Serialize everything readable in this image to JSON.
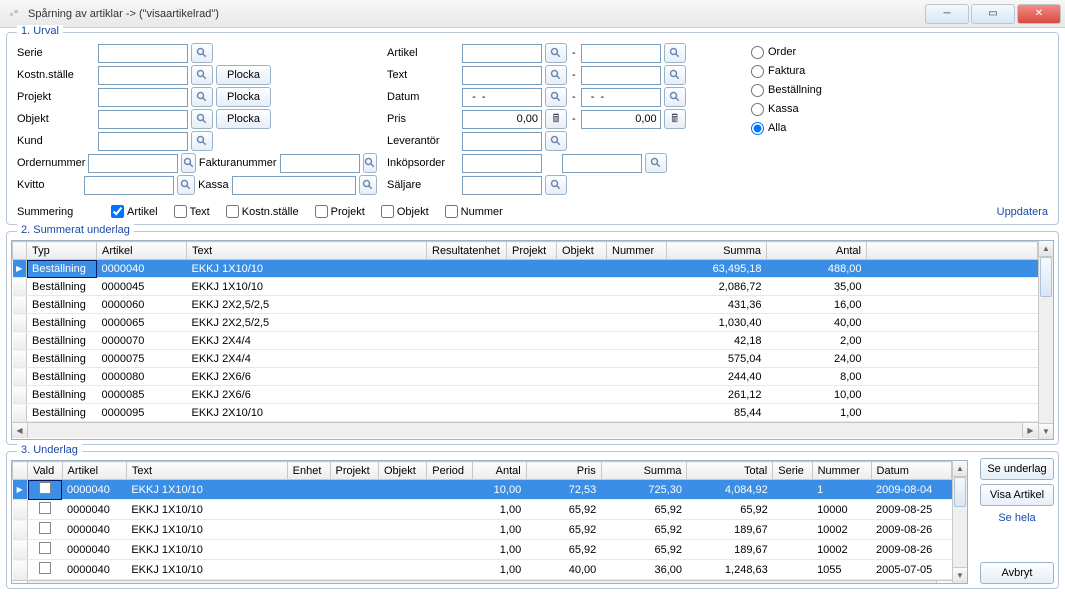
{
  "window": {
    "title": "Spårning av artiklar     -> (\"visaartikelrad\")"
  },
  "urval": {
    "title": "1. Urval",
    "labels": {
      "serie": "Serie",
      "kostn_stalle": "Kostn.ställe",
      "projekt": "Projekt",
      "objekt": "Objekt",
      "kund": "Kund",
      "ordernummer": "Ordernummer",
      "kvitto": "Kvitto",
      "artikel": "Artikel",
      "text": "Text",
      "datum": "Datum",
      "pris": "Pris",
      "leverantor": "Leverantör",
      "fakturanummer": "Fakturanummer",
      "inkopsorder": "Inköpsorder",
      "kassa": "Kassa",
      "saljare": "Säljare",
      "plocka": "Plocka"
    },
    "values": {
      "datum_from": "  -  -",
      "datum_to": "  -  -",
      "pris_from": "0,00",
      "pris_to": "0,00"
    },
    "radios": {
      "order": "Order",
      "faktura": "Faktura",
      "bestallning": "Beställning",
      "kassa": "Kassa",
      "alla": "Alla"
    },
    "summering": {
      "label": "Summering",
      "artikel": "Artikel",
      "text": "Text",
      "kostn_stalle": "Kostn.ställe",
      "projekt": "Projekt",
      "objekt": "Objekt",
      "nummer": "Nummer",
      "uppdatera": "Uppdatera"
    }
  },
  "summerat": {
    "title": "2. Summerat underlag",
    "headers": {
      "typ": "Typ",
      "artikel": "Artikel",
      "text": "Text",
      "resultatenhet": "Resultatenhet",
      "projekt": "Projekt",
      "objekt": "Objekt",
      "nummer": "Nummer",
      "summa": "Summa",
      "antal": "Antal"
    },
    "rows": [
      {
        "typ": "Beställning",
        "artikel": "0000040",
        "text": "EKKJ 1X10/10",
        "summa": "63,495,18",
        "antal": "488,00",
        "sel": true
      },
      {
        "typ": "Beställning",
        "artikel": "0000045",
        "text": "EKKJ 1X10/10",
        "summa": "2,086,72",
        "antal": "35,00"
      },
      {
        "typ": "Beställning",
        "artikel": "0000060",
        "text": "EKKJ 2X2,5/2,5",
        "summa": "431,36",
        "antal": "16,00"
      },
      {
        "typ": "Beställning",
        "artikel": "0000065",
        "text": "EKKJ 2X2,5/2,5",
        "summa": "1,030,40",
        "antal": "40,00"
      },
      {
        "typ": "Beställning",
        "artikel": "0000070",
        "text": "EKKJ 2X4/4",
        "summa": "42,18",
        "antal": "2,00"
      },
      {
        "typ": "Beställning",
        "artikel": "0000075",
        "text": "EKKJ 2X4/4",
        "summa": "575,04",
        "antal": "24,00"
      },
      {
        "typ": "Beställning",
        "artikel": "0000080",
        "text": "EKKJ 2X6/6",
        "summa": "244,40",
        "antal": "8,00"
      },
      {
        "typ": "Beställning",
        "artikel": "0000085",
        "text": "EKKJ 2X6/6",
        "summa": "261,12",
        "antal": "10,00"
      },
      {
        "typ": "Beställning",
        "artikel": "0000095",
        "text": "EKKJ 2X10/10",
        "summa": "85,44",
        "antal": "1,00"
      }
    ]
  },
  "underlag": {
    "title": "3. Underlag",
    "headers": {
      "vald": "Vald",
      "artikel": "Artikel",
      "text": "Text",
      "enhet": "Enhet",
      "projekt": "Projekt",
      "objekt": "Objekt",
      "period": "Period",
      "antal": "Antal",
      "pris": "Pris",
      "summa": "Summa",
      "total": "Total",
      "serie": "Serie",
      "nummer": "Nummer",
      "datum": "Datum"
    },
    "rows": [
      {
        "artikel": "0000040",
        "text": "EKKJ 1X10/10",
        "antal": "10,00",
        "pris": "72,53",
        "summa": "725,30",
        "total": "4,084,92",
        "serie": "",
        "nummer": "1",
        "datum": "2009-08-04",
        "sel": true
      },
      {
        "artikel": "0000040",
        "text": "EKKJ 1X10/10",
        "antal": "1,00",
        "pris": "65,92",
        "summa": "65,92",
        "total": "65,92",
        "serie": "",
        "nummer": "10000",
        "datum": "2009-08-25"
      },
      {
        "artikel": "0000040",
        "text": "EKKJ 1X10/10",
        "antal": "1,00",
        "pris": "65,92",
        "summa": "65,92",
        "total": "189,67",
        "serie": "",
        "nummer": "10002",
        "datum": "2009-08-26"
      },
      {
        "artikel": "0000040",
        "text": "EKKJ 1X10/10",
        "antal": "1,00",
        "pris": "65,92",
        "summa": "65,92",
        "total": "189,67",
        "serie": "",
        "nummer": "10002",
        "datum": "2009-08-26"
      },
      {
        "artikel": "0000040",
        "text": "EKKJ 1X10/10",
        "antal": "1,00",
        "pris": "40,00",
        "summa": "36,00",
        "total": "1,248,63",
        "serie": "",
        "nummer": "1055",
        "datum": "2005-07-05"
      }
    ],
    "buttons": {
      "se_underlag": "Se underlag",
      "visa_artikel": "Visa Artikel",
      "se_hela": "Se hela",
      "avbryt": "Avbryt"
    }
  }
}
